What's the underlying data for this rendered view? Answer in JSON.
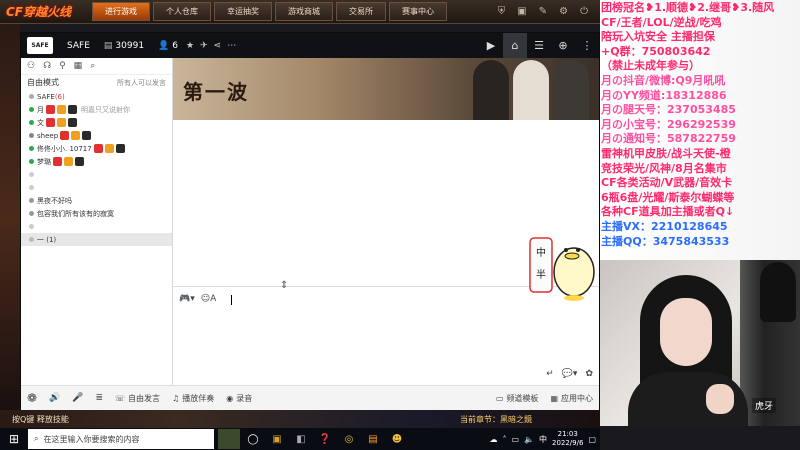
{
  "game_bar": {
    "logo": "CF穿越火线",
    "tabs": [
      "进行游戏",
      "个人仓库",
      "幸运抽奖",
      "游戏商城",
      "交易所",
      "赛事中心"
    ],
    "active_tab_index": 0
  },
  "overlay": {
    "lines": [
      {
        "text": "团榜冠名❥1.顺德❥2.继哥❥3.随风",
        "color": "red"
      },
      {
        "text": "CF/王者/LOL/逆战/吃鸡",
        "color": "red"
      },
      {
        "text": "陪玩入坑安全 主播担保",
        "color": "red"
      },
      {
        "text": "+Q群：750803642",
        "color": "red"
      },
      {
        "text": "（禁止未成年参与）",
        "color": "red"
      },
      {
        "text": "月の抖音/微博:Q9月吼吼",
        "color": "pink"
      },
      {
        "text": "月のYY频道:18312886",
        "color": "pink"
      },
      {
        "text": "月の腿天号：237053485",
        "color": "pink"
      },
      {
        "text": "月の小宝号：296292539",
        "color": "pink"
      },
      {
        "text": "月の通知号：587822759",
        "color": "pink"
      },
      {
        "text": "雷神机甲皮肤/战斗天使-橙",
        "color": "red"
      },
      {
        "text": "竞技荣光/风神/8月名集市",
        "color": "red"
      },
      {
        "text": "CF各类活动/V武器/音效卡",
        "color": "red"
      },
      {
        "text": "6瓶6盘/光耀/斯泰尔蝴蝶等",
        "color": "red"
      },
      {
        "text": "各种CF道具加主播或者Q↓",
        "color": "red"
      },
      {
        "text": "主播VX：2210128645",
        "color": "blue"
      },
      {
        "text": "主播QQ：3475843533",
        "color": "blue"
      }
    ]
  },
  "yy": {
    "logo": "SAFE",
    "channel_name": "SAFE",
    "channel_id": "30991",
    "online_count": "6",
    "sidebar": {
      "mode_label": "自由模式",
      "mode_right": "所有人可以发言",
      "rows": [
        {
          "text": "SAFE",
          "suffix": "(6)",
          "sub": ""
        },
        {
          "text": "月",
          "suffix": "",
          "sub": "明嘉只又说射你"
        },
        {
          "text": "文",
          "suffix": "",
          "sub": ""
        },
        {
          "text": "sheep",
          "suffix": "",
          "sub": ""
        },
        {
          "text": "佟佟小小. 10717",
          "suffix": "",
          "sub": ""
        },
        {
          "text": "梦璐",
          "suffix": "",
          "sub": ""
        },
        {
          "text": "",
          "suffix": "",
          "sub": ""
        },
        {
          "text": "",
          "suffix": "",
          "sub": ""
        },
        {
          "text": "黑夜不好吗",
          "suffix": "",
          "sub": ""
        },
        {
          "text": "包容我们所有该有的寂寞",
          "suffix": "",
          "sub": ""
        },
        {
          "text": "",
          "suffix": "",
          "sub": ""
        },
        {
          "text": "一  (1)",
          "suffix": "",
          "sub": ""
        }
      ]
    },
    "banner_text": "第一波",
    "sticker_text": [
      "中",
      "半"
    ],
    "bottom_bar": {
      "items": [
        "自由发言",
        "播放伴奏",
        "录音"
      ],
      "right": [
        "频道模板",
        "应用中心"
      ]
    }
  },
  "scene": {
    "bottom_left_text": "按Q键 释放技能",
    "bottom_right_text": "当前章节：黑暗之鏡"
  },
  "taskbar": {
    "search_placeholder": "在这里输入你要搜索的内容",
    "time": "21:03",
    "date": "2022/9/6"
  }
}
